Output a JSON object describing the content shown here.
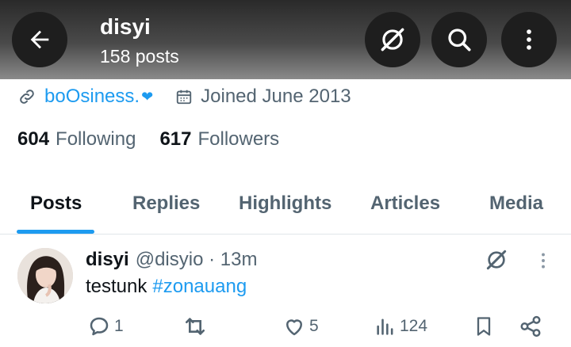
{
  "header": {
    "name": "disyi",
    "posts_count": "158 posts",
    "back_icon": "arrow-left-icon",
    "grok_icon": "grok-icon",
    "search_icon": "search-icon",
    "more_icon": "more-vertical-icon"
  },
  "profile": {
    "website": "boOsiness.",
    "joined": "Joined June 2013",
    "following_count": "604",
    "following_label": "Following",
    "followers_count": "617",
    "followers_label": "Followers"
  },
  "tabs": [
    {
      "label": "Posts",
      "active": true
    },
    {
      "label": "Replies",
      "active": false
    },
    {
      "label": "Highlights",
      "active": false
    },
    {
      "label": "Articles",
      "active": false
    },
    {
      "label": "Media",
      "active": false
    }
  ],
  "post": {
    "author": "disyi",
    "handle_time": "@disyio · 13m",
    "text": "testunk",
    "hashtag": "#zonauang",
    "replies": "1",
    "likes": "5",
    "views": "124"
  },
  "colors": {
    "accent": "#1d9bf0",
    "text_primary": "#0f1419",
    "text_secondary": "#536471"
  }
}
